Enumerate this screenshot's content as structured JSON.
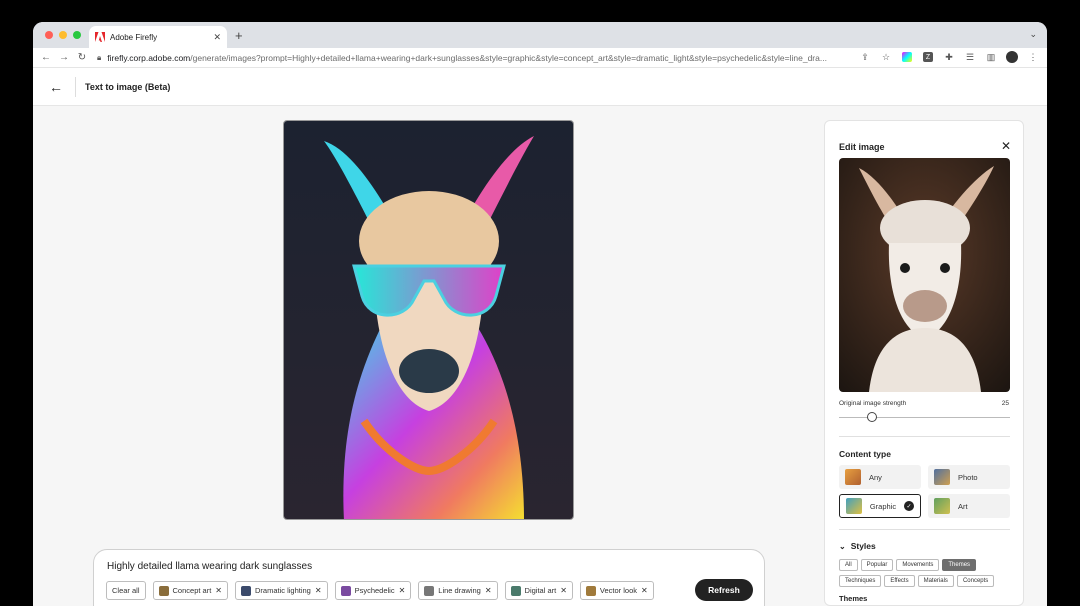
{
  "browser": {
    "tab_title": "Adobe Firefly",
    "url_host": "firefly.corp.adobe.com",
    "url_path": "/generate/images?prompt=Highly+detailed+llama+wearing+dark+sunglasses&style=graphic&style=concept_art&style=dramatic_light&style=psychedelic&style=line_dra..."
  },
  "header": {
    "title": "Text to image (Beta)"
  },
  "prompt": {
    "text": "Highly detailed llama wearing dark sunglasses",
    "clear_label": "Clear all",
    "chips": [
      {
        "label": "Concept art",
        "color": "#8a6d3b"
      },
      {
        "label": "Dramatic lighting",
        "color": "#3b4a6b"
      },
      {
        "label": "Psychedelic",
        "color": "#7a4aa0"
      },
      {
        "label": "Line drawing",
        "color": "#777777"
      },
      {
        "label": "Digital art",
        "color": "#4a7a6b"
      },
      {
        "label": "Vector look",
        "color": "#a07a3b"
      }
    ],
    "refresh_label": "Refresh"
  },
  "panel": {
    "title": "Edit image",
    "strength_label": "Original image strength",
    "strength_value": "25",
    "content_type_title": "Content type",
    "content_types": [
      {
        "label": "Any",
        "selected": false
      },
      {
        "label": "Photo",
        "selected": false
      },
      {
        "label": "Graphic",
        "selected": true
      },
      {
        "label": "Art",
        "selected": false
      }
    ],
    "styles_title": "Styles",
    "styles_row1": [
      "All",
      "Popular",
      "Movements",
      "Themes"
    ],
    "styles_row2": [
      "Techniques",
      "Effects",
      "Materials",
      "Concepts"
    ],
    "styles_active": "Themes",
    "themes_title": "Themes"
  }
}
